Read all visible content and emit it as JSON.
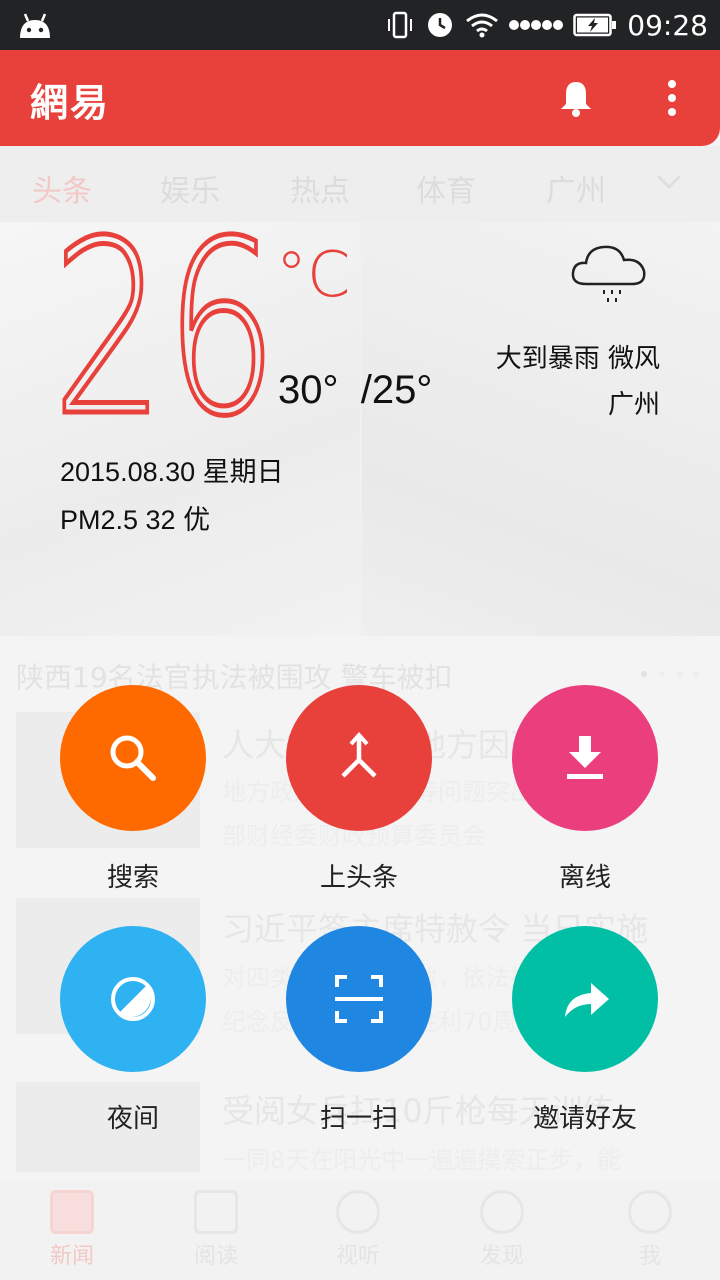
{
  "status_bar": {
    "time": "09:28"
  },
  "app_bar": {
    "logo": "網易"
  },
  "tabs": [
    {
      "label": "头条",
      "active": true
    },
    {
      "label": "娱乐"
    },
    {
      "label": "热点"
    },
    {
      "label": "体育"
    },
    {
      "label": "广州"
    }
  ],
  "weather": {
    "temperature": "26",
    "unit": "°C",
    "high": "30°",
    "low": "/25°",
    "date": "2015.08.30 星期日",
    "pm25": "PM2.5 32 优",
    "condition": "大到暴雨  微风",
    "city": "广州"
  },
  "feed": {
    "headline": "陕西19名法官执法被围攻 警车被扣",
    "items": [
      {
        "title": "人大常委会：地方因违法",
        "sub1": "地方政府违规举债等问题突出，运行",
        "sub2": "部财经委财政预算委员会"
      },
      {
        "title": "习近平签主席特赦令 当日实施",
        "sub1": "对四类罪犯实行特赦，依法执行刑罚",
        "sub2": "纪念反法西斯战争胜利70周年"
      },
      {
        "title": "受阅女兵扛10斤枪每天训练",
        "sub1": "一同8天在阳光中一遍遍摸索正步，能",
        "sub2": ""
      }
    ]
  },
  "actions": [
    {
      "label": "搜索",
      "icon": "search-icon",
      "color": "#ff6a00"
    },
    {
      "label": "上头条",
      "icon": "merge-arrow-icon",
      "color": "#e8413c"
    },
    {
      "label": "离线",
      "icon": "download-icon",
      "color": "#ea3f7c"
    },
    {
      "label": "夜间",
      "icon": "night-mode-icon",
      "color": "#2fb2f2"
    },
    {
      "label": "扫一扫",
      "icon": "scan-icon",
      "color": "#1f86e2"
    },
    {
      "label": "邀请好友",
      "icon": "share-icon",
      "color": "#00bfa5"
    }
  ],
  "bottom_nav": [
    {
      "label": "新闻",
      "active": true
    },
    {
      "label": "阅读"
    },
    {
      "label": "视听"
    },
    {
      "label": "发现"
    },
    {
      "label": "我"
    }
  ],
  "colors": {
    "accent": "#e8413c",
    "status_bar": "#222325"
  }
}
